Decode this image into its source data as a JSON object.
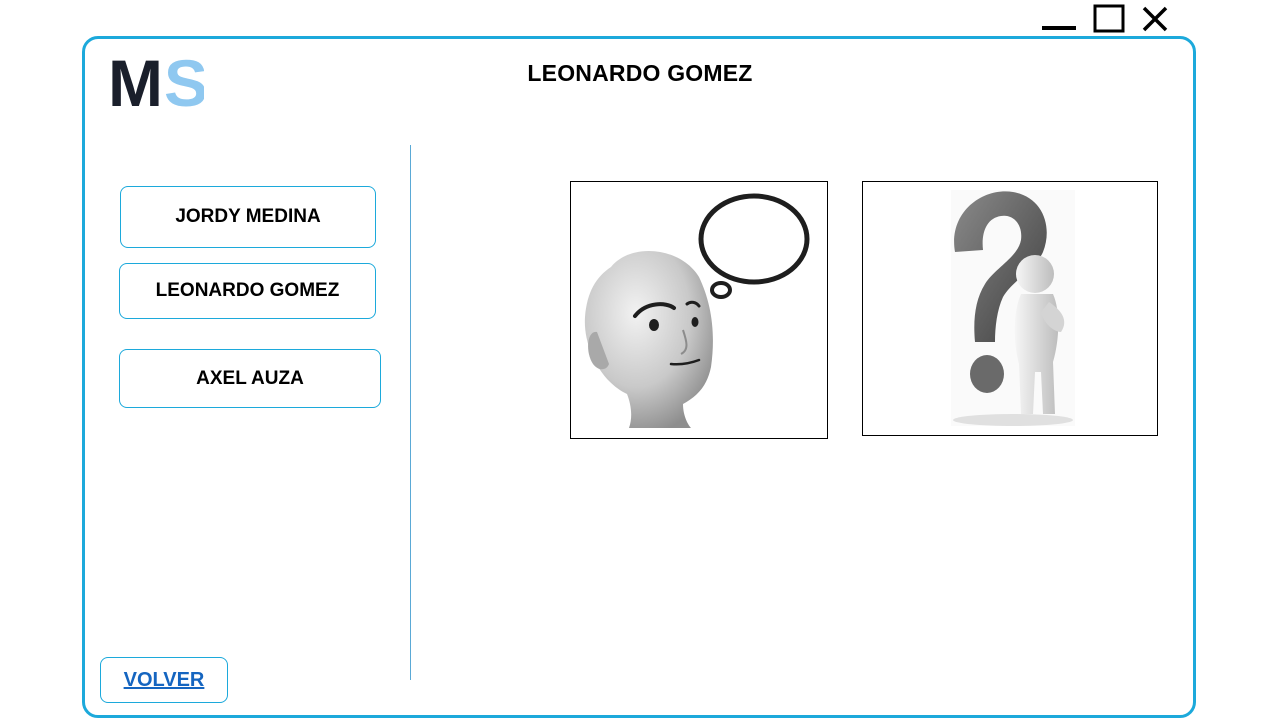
{
  "window": {
    "controls": [
      "minimize-icon",
      "maximize-icon",
      "close-icon"
    ]
  },
  "logo": {
    "text_left": "M",
    "text_right": "S",
    "color_left": "#1a1f2b",
    "color_right": "#8fc8f0"
  },
  "header": {
    "title": "LEONARDO GOMEZ"
  },
  "sidebar": {
    "items": [
      {
        "label": "JORDY MEDINA"
      },
      {
        "label": "LEONARDO GOMEZ"
      },
      {
        "label": "AXEL AUZA"
      }
    ],
    "back_label": "VOLVER"
  },
  "content": {
    "images": [
      "thinking-head-icon",
      "question-mark-person-icon"
    ]
  },
  "colors": {
    "accent": "#1ca9db",
    "link": "#1565c0"
  }
}
